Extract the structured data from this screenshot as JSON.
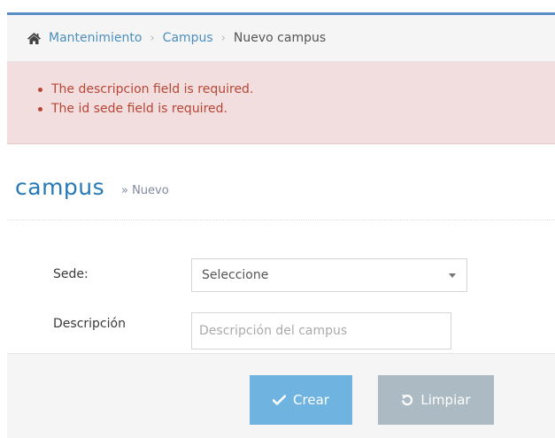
{
  "breadcrumb": {
    "items": [
      "Mantenimiento",
      "Campus"
    ],
    "separator": "›",
    "current": "Nuevo campus"
  },
  "alert": {
    "errors": [
      "The descripcion field is required.",
      "The id sede field is required."
    ]
  },
  "header": {
    "title": "campus",
    "subtitle": "» Nuevo"
  },
  "form": {
    "sede_label": "Sede:",
    "sede_value": "Seleccione",
    "descripcion_label": "Descripción",
    "descripcion_placeholder": "Descripción del campus",
    "descripcion_value": ""
  },
  "actions": {
    "create_label": "Crear",
    "clear_label": "Limpiar"
  },
  "icons": {
    "home": "home-icon",
    "create": "check-icon",
    "clear": "undo-icon",
    "select": "caret-down-icon"
  },
  "colors": {
    "link": "#4c8fbd",
    "title": "#2679b5",
    "error_bg": "#f2dede",
    "error_text": "#b74635",
    "primary_button": "#6fb3e0",
    "secondary_button": "#abbac3"
  }
}
